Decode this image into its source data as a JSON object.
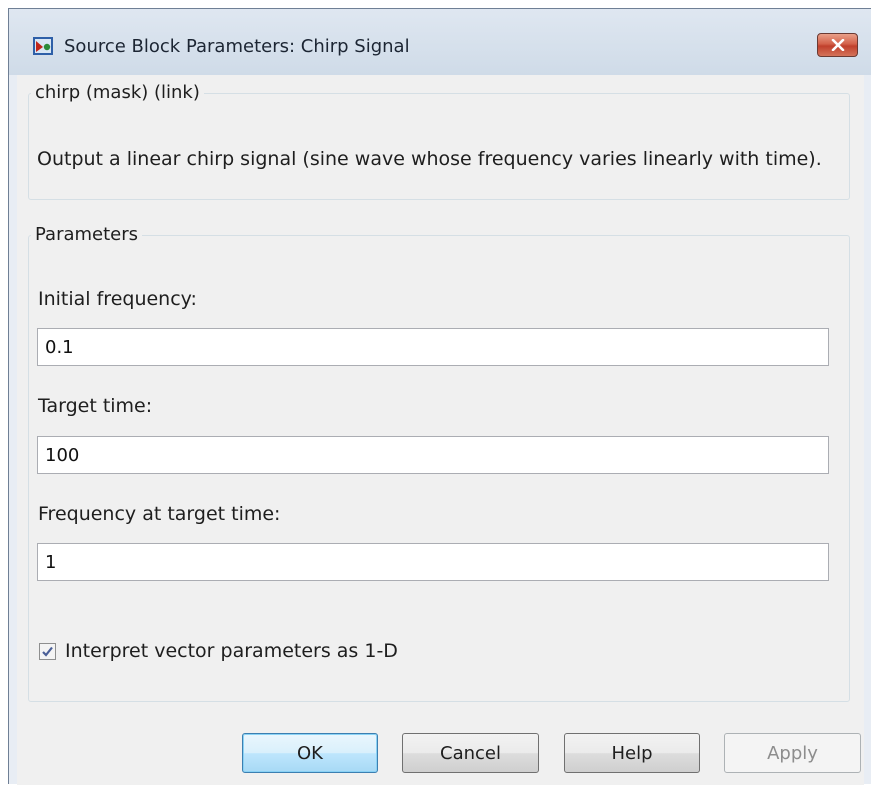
{
  "window": {
    "title": "Source Block Parameters: Chirp Signal",
    "close_label": "✕"
  },
  "description_group": {
    "legend": "chirp (mask) (link)",
    "text": "Output a linear chirp signal (sine wave  whose frequency varies linearly with time)."
  },
  "parameters_group": {
    "legend": "Parameters",
    "fields": [
      {
        "label": "Initial frequency:",
        "value": "0.1"
      },
      {
        "label": "Target time:",
        "value": "100"
      },
      {
        "label": "Frequency at target time:",
        "value": "1"
      }
    ],
    "checkbox": {
      "label": "Interpret vector parameters as 1-D",
      "checked": true
    }
  },
  "buttons": {
    "ok": "OK",
    "cancel": "Cancel",
    "help": "Help",
    "apply": "Apply"
  },
  "colors": {
    "client_bg": "#f0f0f0",
    "titlebar_bg": "#dfe7f1",
    "close_button": "#c94a35",
    "default_button_border": "#3c7fb1"
  },
  "icons": {
    "app": "simulink-block-icon",
    "close": "close-icon",
    "check": "checkmark-icon"
  }
}
